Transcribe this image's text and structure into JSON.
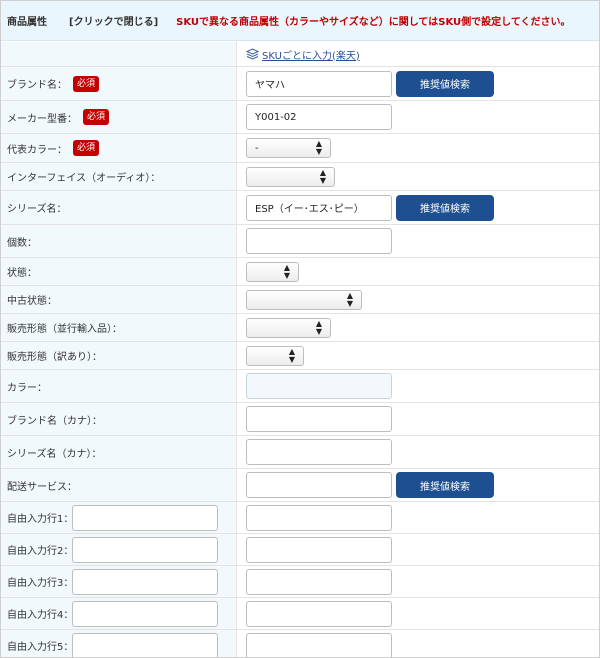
{
  "header": {
    "title": "商品属性",
    "toggle_label": "[クリックで閉じる]",
    "note": "SKUで異なる商品属性（カラーやサイズなど）に関してはSKU側で設定してください。"
  },
  "sku_link": {
    "label": "SKUごとに入力(楽天)",
    "icon": "layers-icon"
  },
  "required_label": "必須",
  "search_button_label": "推奨値検索",
  "fields": {
    "brand": {
      "label": "ブランド名：",
      "value": "ヤマハ"
    },
    "model_number": {
      "label": "メーカー型番：",
      "value": "Y001-02"
    },
    "color_rep": {
      "label": "代表カラー：",
      "selected": "-"
    },
    "interface": {
      "label": "インターフェイス（オーディオ）：",
      "selected": ""
    },
    "series": {
      "label": "シリーズ名：",
      "value": "ESP（イー･エス･ピー）"
    },
    "count": {
      "label": "個数：",
      "value": ""
    },
    "condition": {
      "label": "状態：",
      "selected": ""
    },
    "used_condition": {
      "label": "中古状態：",
      "selected": ""
    },
    "sales_parallel": {
      "label": "販売形態（並行輸入品）：",
      "selected": ""
    },
    "sales_outlet": {
      "label": "販売形態（訳あり）：",
      "selected": ""
    },
    "color": {
      "label": "カラー：",
      "value": ""
    },
    "brand_kana": {
      "label": "ブランド名（カナ）：",
      "value": ""
    },
    "series_kana": {
      "label": "シリーズ名（カナ）：",
      "value": ""
    },
    "delivery": {
      "label": "配送サービス：",
      "value": ""
    }
  },
  "free_rows": [
    {
      "label": "自由入力行1：",
      "name_value": "",
      "value": ""
    },
    {
      "label": "自由入力行2：",
      "name_value": "",
      "value": ""
    },
    {
      "label": "自由入力行3：",
      "name_value": "",
      "value": ""
    },
    {
      "label": "自由入力行4：",
      "name_value": "",
      "value": ""
    },
    {
      "label": "自由入力行5：",
      "name_value": "",
      "value": ""
    }
  ],
  "colors": {
    "header_bg": "#eaf6fd",
    "label_bg": "#f2f9fd",
    "required_bg": "#c40000",
    "note_text": "#c00000",
    "button_bg": "#1d4f91",
    "link_text": "#2a4f9a"
  }
}
